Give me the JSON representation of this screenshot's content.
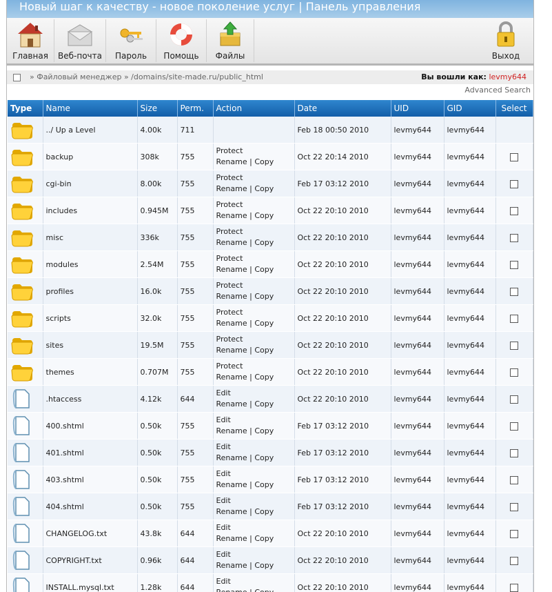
{
  "banner": {
    "title": "Новый шаг к качеству - новое поколение услуг | Панель управления"
  },
  "toolbar": {
    "home": "Главная",
    "webmail": "Веб-почта",
    "password": "Пароль",
    "help": "Помощь",
    "files": "Файлы",
    "logout": "Выход"
  },
  "path": {
    "crumb": "» Файловый менеджер » /domains/site-made.ru/public_html",
    "logged_label": "Вы вошли как:",
    "user": "levmy644",
    "advanced_search": "Advanced Search"
  },
  "table": {
    "headers": {
      "type": "Type",
      "name": "Name",
      "size": "Size",
      "perm": "Perm.",
      "action": "Action",
      "date": "Date",
      "uid": "UID",
      "gid": "GID",
      "select": "Select"
    },
    "rows": [
      {
        "kind": "folder",
        "name": "../ Up a Level",
        "size": "4.00k",
        "perm": "711",
        "action1": "",
        "action2": "",
        "action_sep": "",
        "action3": "",
        "date": "Feb 18 00:50 2010",
        "uid": "levmy644",
        "gid": "levmy644",
        "select": false
      },
      {
        "kind": "folder",
        "name": "backup",
        "size": "308k",
        "perm": "755",
        "action1": "Protect",
        "action2": "Rename",
        "action_sep": "|",
        "action3": "Copy",
        "date": "Oct 22 20:14 2010",
        "uid": "levmy644",
        "gid": "levmy644",
        "select": true
      },
      {
        "kind": "folder",
        "name": "cgi-bin",
        "size": "8.00k",
        "perm": "755",
        "action1": "Protect",
        "action2": "Rename",
        "action_sep": "|",
        "action3": "Copy",
        "date": "Feb 17 03:12 2010",
        "uid": "levmy644",
        "gid": "levmy644",
        "select": true
      },
      {
        "kind": "folder",
        "name": "includes",
        "size": "0.945M",
        "perm": "755",
        "action1": "Protect",
        "action2": "Rename",
        "action_sep": "|",
        "action3": "Copy",
        "date": "Oct 22 20:10 2010",
        "uid": "levmy644",
        "gid": "levmy644",
        "select": true
      },
      {
        "kind": "folder",
        "name": "misc",
        "size": "336k",
        "perm": "755",
        "action1": "Protect",
        "action2": "Rename",
        "action_sep": "|",
        "action3": "Copy",
        "date": "Oct 22 20:10 2010",
        "uid": "levmy644",
        "gid": "levmy644",
        "select": true
      },
      {
        "kind": "folder",
        "name": "modules",
        "size": "2.54M",
        "perm": "755",
        "action1": "Protect",
        "action2": "Rename",
        "action_sep": "|",
        "action3": "Copy",
        "date": "Oct 22 20:10 2010",
        "uid": "levmy644",
        "gid": "levmy644",
        "select": true
      },
      {
        "kind": "folder",
        "name": "profiles",
        "size": "16.0k",
        "perm": "755",
        "action1": "Protect",
        "action2": "Rename",
        "action_sep": "|",
        "action3": "Copy",
        "date": "Oct 22 20:10 2010",
        "uid": "levmy644",
        "gid": "levmy644",
        "select": true
      },
      {
        "kind": "folder",
        "name": "scripts",
        "size": "32.0k",
        "perm": "755",
        "action1": "Protect",
        "action2": "Rename",
        "action_sep": "|",
        "action3": "Copy",
        "date": "Oct 22 20:10 2010",
        "uid": "levmy644",
        "gid": "levmy644",
        "select": true
      },
      {
        "kind": "folder",
        "name": "sites",
        "size": "19.5M",
        "perm": "755",
        "action1": "Protect",
        "action2": "Rename",
        "action_sep": "|",
        "action3": "Copy",
        "date": "Oct 22 20:10 2010",
        "uid": "levmy644",
        "gid": "levmy644",
        "select": true
      },
      {
        "kind": "folder",
        "name": "themes",
        "size": "0.707M",
        "perm": "755",
        "action1": "Protect",
        "action2": "Rename",
        "action_sep": "|",
        "action3": "Copy",
        "date": "Oct 22 20:10 2010",
        "uid": "levmy644",
        "gid": "levmy644",
        "select": true
      },
      {
        "kind": "file",
        "name": ".htaccess",
        "size": "4.12k",
        "perm": "644",
        "action1": "Edit",
        "action2": "Rename",
        "action_sep": "|",
        "action3": "Copy",
        "date": "Oct 22 20:10 2010",
        "uid": "levmy644",
        "gid": "levmy644",
        "select": true
      },
      {
        "kind": "file",
        "name": "400.shtml",
        "size": "0.50k",
        "perm": "755",
        "action1": "Edit",
        "action2": "Rename",
        "action_sep": "|",
        "action3": "Copy",
        "date": "Feb 17 03:12 2010",
        "uid": "levmy644",
        "gid": "levmy644",
        "select": true
      },
      {
        "kind": "file",
        "name": "401.shtml",
        "size": "0.50k",
        "perm": "755",
        "action1": "Edit",
        "action2": "Rename",
        "action_sep": "|",
        "action3": "Copy",
        "date": "Feb 17 03:12 2010",
        "uid": "levmy644",
        "gid": "levmy644",
        "select": true
      },
      {
        "kind": "file",
        "name": "403.shtml",
        "size": "0.50k",
        "perm": "755",
        "action1": "Edit",
        "action2": "Rename",
        "action_sep": "|",
        "action3": "Copy",
        "date": "Feb 17 03:12 2010",
        "uid": "levmy644",
        "gid": "levmy644",
        "select": true
      },
      {
        "kind": "file",
        "name": "404.shtml",
        "size": "0.50k",
        "perm": "755",
        "action1": "Edit",
        "action2": "Rename",
        "action_sep": "|",
        "action3": "Copy",
        "date": "Feb 17 03:12 2010",
        "uid": "levmy644",
        "gid": "levmy644",
        "select": true
      },
      {
        "kind": "file",
        "name": "CHANGELOG.txt",
        "size": "43.8k",
        "perm": "644",
        "action1": "Edit",
        "action2": "Rename",
        "action_sep": "|",
        "action3": "Copy",
        "date": "Oct 22 20:10 2010",
        "uid": "levmy644",
        "gid": "levmy644",
        "select": true
      },
      {
        "kind": "file",
        "name": "COPYRIGHT.txt",
        "size": "0.96k",
        "perm": "644",
        "action1": "Edit",
        "action2": "Rename",
        "action_sep": "|",
        "action3": "Copy",
        "date": "Oct 22 20:10 2010",
        "uid": "levmy644",
        "gid": "levmy644",
        "select": true
      },
      {
        "kind": "file",
        "name": "INSTALL.mysql.txt",
        "size": "1.28k",
        "perm": "644",
        "action1": "Edit",
        "action2": "Rename",
        "action_sep": "|",
        "action3": "Copy",
        "date": "Oct 22 20:10 2010",
        "uid": "levmy644",
        "gid": "levmy644",
        "select": true
      }
    ]
  },
  "icons": {
    "home": "house-icon",
    "webmail": "envelope-icon",
    "password": "keys-icon",
    "help": "lifebuoy-icon",
    "files": "file-box-icon",
    "logout": "padlock-icon",
    "folder": "folder-icon",
    "file": "document-icon"
  },
  "colors": {
    "header_blue": "#1d6fba",
    "user_red": "#d02020",
    "banner": "#8fbde4"
  }
}
